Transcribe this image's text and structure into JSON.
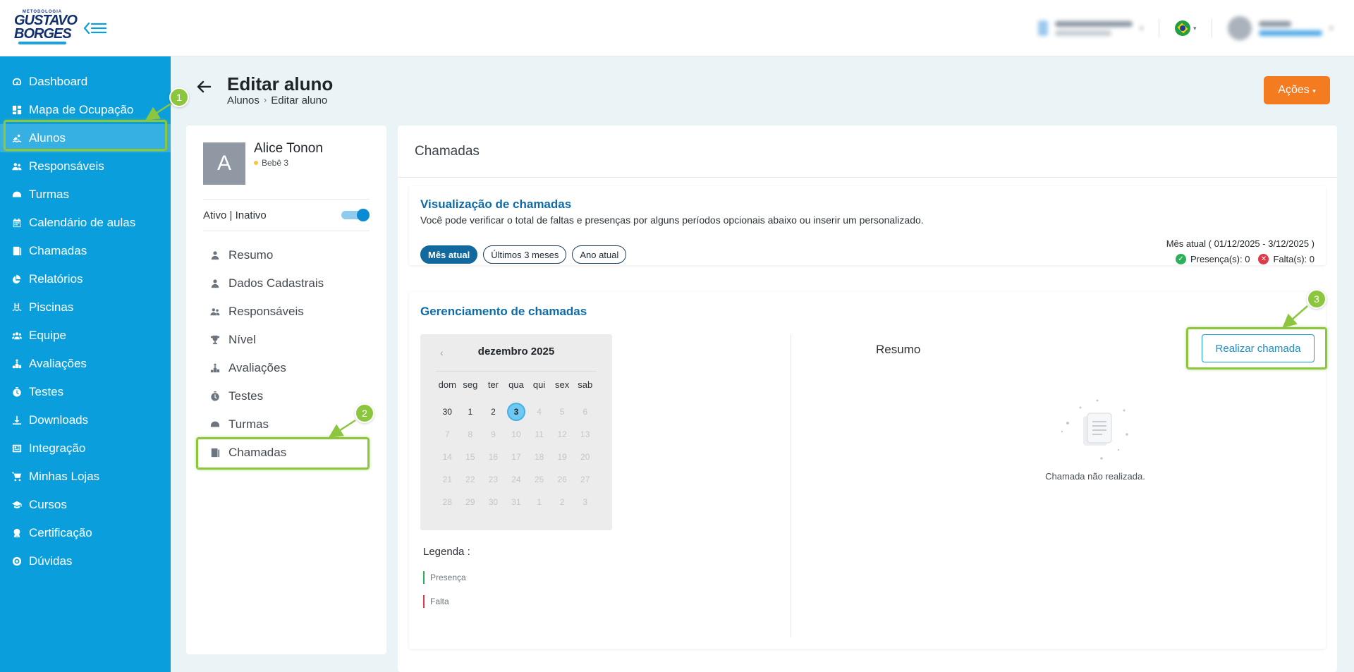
{
  "brand": {
    "line1": "METODOLOGIA",
    "line2": "GUSTAVO",
    "line3": "BORGES"
  },
  "sidebar": {
    "items": [
      {
        "label": "Dashboard",
        "icon": "gauge-icon"
      },
      {
        "label": "Mapa de Ocupação",
        "icon": "grid-icon"
      },
      {
        "label": "Alunos",
        "icon": "swimmer-icon"
      },
      {
        "label": "Responsáveis",
        "icon": "users-icon"
      },
      {
        "label": "Turmas",
        "icon": "helmet-icon"
      },
      {
        "label": "Calendário de aulas",
        "icon": "calendar-icon"
      },
      {
        "label": "Chamadas",
        "icon": "list-icon"
      },
      {
        "label": "Relatórios",
        "icon": "chart-icon"
      },
      {
        "label": "Piscinas",
        "icon": "pool-icon"
      },
      {
        "label": "Equipe",
        "icon": "team-icon"
      },
      {
        "label": "Avaliações",
        "icon": "podium-icon"
      },
      {
        "label": "Testes",
        "icon": "stopwatch-icon"
      },
      {
        "label": "Downloads",
        "icon": "download-icon"
      },
      {
        "label": "Integração",
        "icon": "integration-icon"
      },
      {
        "label": "Minhas Lojas",
        "icon": "cart-icon"
      },
      {
        "label": "Cursos",
        "icon": "graduation-icon"
      },
      {
        "label": "Certificação",
        "icon": "badge-icon"
      },
      {
        "label": "Dúvidas",
        "icon": "help-icon"
      }
    ]
  },
  "header": {
    "title": "Editar aluno",
    "breadcrumb_root": "Alunos",
    "breadcrumb_sep": "›",
    "breadcrumb_current": "Editar aluno",
    "actions_label": "Ações"
  },
  "student": {
    "initial": "A",
    "name": "Alice Tonon",
    "level": "Bebê 3",
    "status_label": "Ativo | Inativo",
    "menu": [
      {
        "label": "Resumo",
        "icon": "person-icon"
      },
      {
        "label": "Dados Cadastrais",
        "icon": "person-icon"
      },
      {
        "label": "Responsáveis",
        "icon": "users-icon"
      },
      {
        "label": "Nível",
        "icon": "trophy-icon"
      },
      {
        "label": "Avaliações",
        "icon": "podium-icon"
      },
      {
        "label": "Testes",
        "icon": "stopwatch-icon"
      },
      {
        "label": "Turmas",
        "icon": "helmet-icon"
      },
      {
        "label": "Chamadas",
        "icon": "list-icon"
      }
    ]
  },
  "panel": {
    "title": "Chamadas",
    "viz": {
      "title": "Visualização de chamadas",
      "description": "Você pode verificar o total de faltas e presenças por alguns períodos opcionais abaixo ou inserir um personalizado.",
      "pills": [
        "Mês atual",
        "Últimos 3 meses",
        "Ano atual"
      ],
      "period": "Mês atual ( 01/12/2025 - 3/12/2025 )",
      "presence": "Presença(s): 0",
      "absence": "Falta(s): 0"
    },
    "mgmt": {
      "title": "Gerenciamento de chamadas",
      "month": "dezembro 2025",
      "weekdays": [
        "dom",
        "seg",
        "ter",
        "qua",
        "qui",
        "sex",
        "sab"
      ],
      "days": [
        "30",
        "1",
        "2",
        "3",
        "4",
        "5",
        "6",
        "7",
        "8",
        "9",
        "10",
        "11",
        "12",
        "13",
        "14",
        "15",
        "16",
        "17",
        "18",
        "19",
        "20",
        "21",
        "22",
        "23",
        "24",
        "25",
        "26",
        "27",
        "28",
        "29",
        "30",
        "31",
        "1",
        "2",
        "3"
      ],
      "today_index": 3,
      "active_range": [
        0,
        3
      ],
      "legend_title": "Legenda :",
      "legend_presence": "Presença",
      "legend_absence": "Falta",
      "resumo": "Resumo",
      "realizar_label": "Realizar chamada",
      "empty_text": "Chamada não realizada."
    }
  },
  "steps": [
    "1",
    "2",
    "3"
  ],
  "colors": {
    "sidebar": "#0a9fdc",
    "accent_orange": "#f47b20",
    "highlight_green": "#8cc63f",
    "title_blue": "#0f6ba8"
  }
}
